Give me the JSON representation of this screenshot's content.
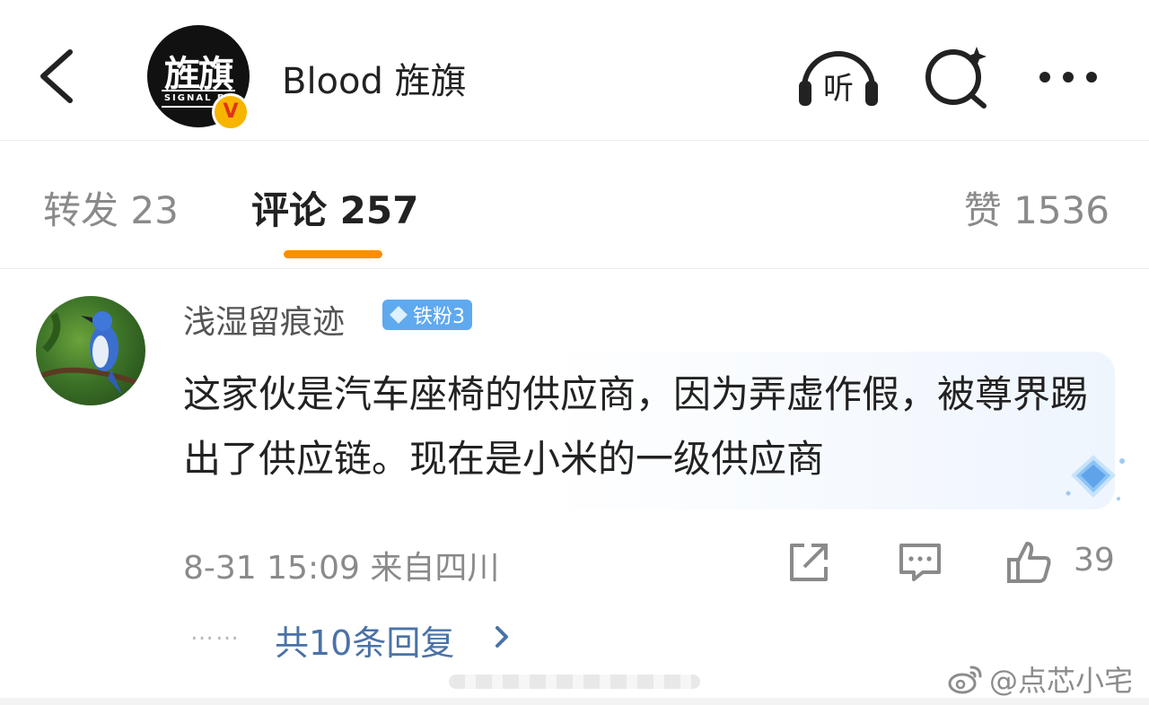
{
  "header": {
    "account_name": "Blood 旌旗",
    "avatar_text": "旌旗",
    "avatar_sub": "SIGNAL FL",
    "verified_mark": "V",
    "listen_label": "听",
    "icons": [
      "back-icon",
      "listen-icon",
      "search-icon",
      "more-icon"
    ]
  },
  "tabs": {
    "forward": "转发 23",
    "comments": "评论 257",
    "likes": "赞 1536",
    "active": "comments",
    "accent_color": "#ff8d00"
  },
  "comment": {
    "user": "浅湿留痕迹",
    "badge": "铁粉3",
    "text": "这家伙是汽车座椅的供应商，因为弄虚作假，被尊界踢出了供应链。现在是小米的一级供应商",
    "meta": "8-31 15:09 来自四川",
    "like_count": "39",
    "reply_dots": "……",
    "replies_link": "共10条回复",
    "icons": [
      "share-icon",
      "reply-icon",
      "like-icon"
    ]
  },
  "watermark": {
    "text": "@点芯小宅"
  },
  "colors": {
    "link": "#4a72a8",
    "badge": "#5fa9ef",
    "muted": "#8a8a8a"
  }
}
